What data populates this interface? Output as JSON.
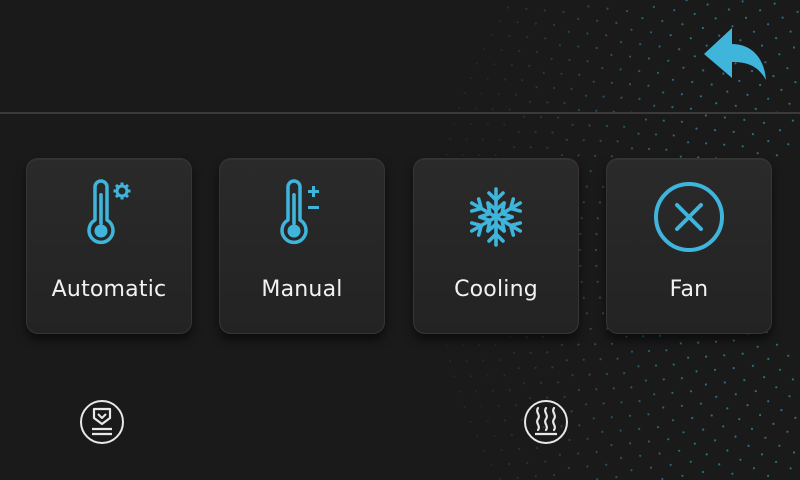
{
  "screen": {
    "accent_color": "#3fb5dc",
    "background_color": "#1a1a1a"
  },
  "header": {
    "back_icon": "back-arrow-icon"
  },
  "modes": [
    {
      "id": "automatic",
      "label": "Automatic",
      "icon": "thermometer-gear-icon"
    },
    {
      "id": "manual",
      "label": "Manual",
      "icon": "thermometer-plus-minus-icon"
    },
    {
      "id": "cooling",
      "label": "Cooling",
      "icon": "snowflake-icon"
    },
    {
      "id": "fan",
      "label": "Fan",
      "icon": "circle-x-icon"
    }
  ],
  "footer": {
    "left_icon": "heating-element-icon",
    "right_icon": "heat-waves-icon"
  }
}
